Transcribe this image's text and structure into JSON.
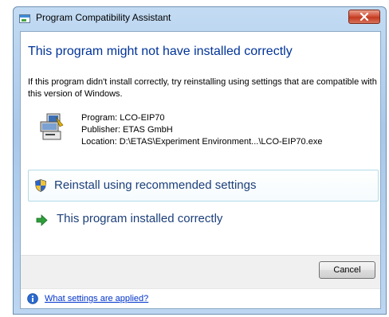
{
  "window": {
    "title": "Program Compatibility Assistant",
    "close_icon": "close-x-icon"
  },
  "main": {
    "headline": "This program might not have installed correctly",
    "intro": "If this program didn't install correctly, try reinstalling using settings that are compatible with this version of Windows.",
    "program_line": "Program: LCO-EIP70",
    "publisher_line": "Publisher: ETAS GmbH",
    "location_line": "Location: D:\\ETAS\\Experiment Environment...\\LCO-EIP70.exe"
  },
  "commands": {
    "reinstall_label": "Reinstall using recommended settings",
    "reinstall_icon": "uac-shield-icon",
    "installed_label": "This program installed correctly",
    "installed_icon": "green-arrow-icon"
  },
  "footer": {
    "cancel_label": "Cancel"
  },
  "help": {
    "link_text": "What settings are applied?",
    "icon": "info-icon"
  },
  "colors": {
    "headline": "#003399",
    "command_text": "#1c3f7a",
    "link": "#0033cc",
    "titlebar": "#a9c8ea",
    "close_button": "#c23a1f"
  }
}
